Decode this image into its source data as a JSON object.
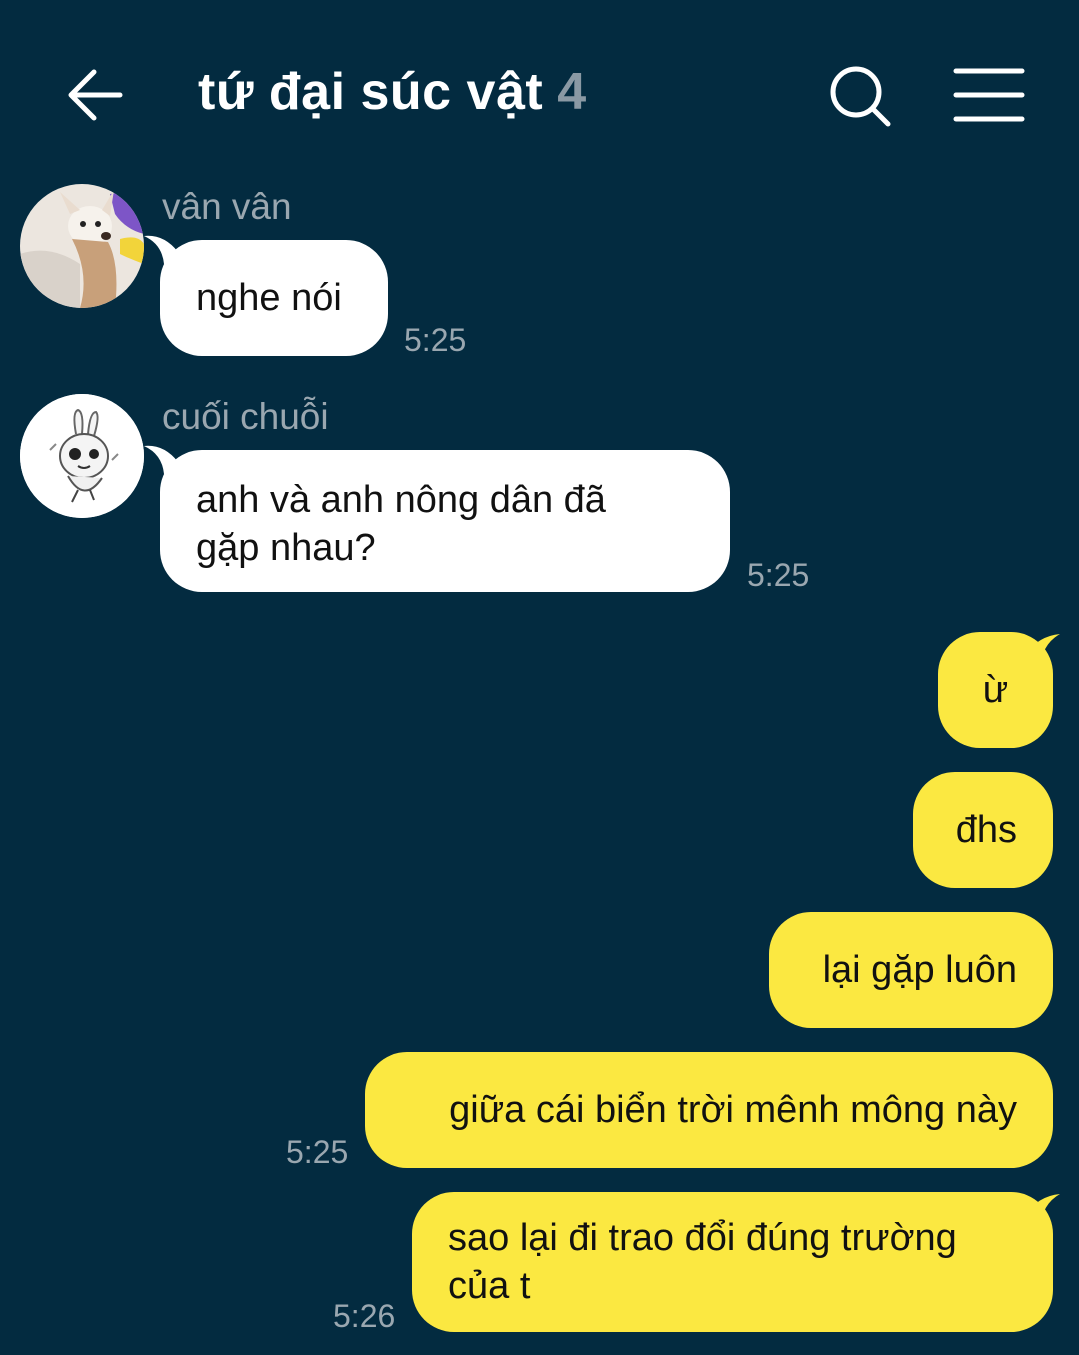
{
  "header": {
    "title": "tứ đại súc vật",
    "member_count": "4"
  },
  "icons": {
    "back": "arrow-left-icon",
    "search": "search-icon",
    "menu": "hamburger-menu-icon"
  },
  "colors": {
    "background": "#032b40",
    "incoming_bubble": "#ffffff",
    "outgoing_bubble": "#fbe841",
    "meta_text": "#9aa7b0"
  },
  "messages": {
    "m1": {
      "sender": "vân vân",
      "text": "nghe nói",
      "time": "5:25"
    },
    "m2": {
      "sender": "cuối chuỗi",
      "line1": "anh và anh nông dân đã",
      "line2": "gặp nhau?",
      "time": "5:25"
    },
    "o1": {
      "text": "ừ"
    },
    "o2": {
      "text": "đhs"
    },
    "o3": {
      "text": "lại gặp luôn"
    },
    "o4": {
      "text": "giữa cái biển trời mênh mông này",
      "time": "5:25"
    },
    "o5": {
      "line1": "sao lại đi trao đổi đúng trường",
      "line2": "của t",
      "time": "5:26"
    }
  }
}
